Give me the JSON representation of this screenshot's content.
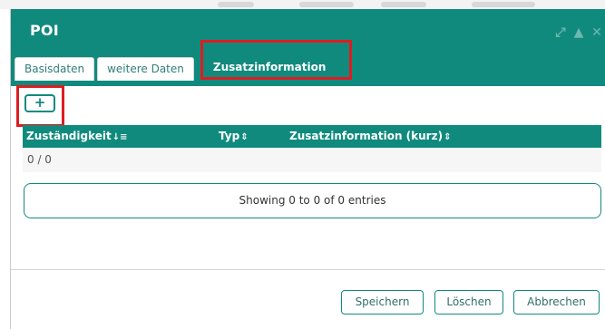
{
  "dialog": {
    "title": "POI",
    "window_controls": [
      "expand-icon",
      "arrow-up-icon",
      "close-icon"
    ]
  },
  "tabs": [
    {
      "label": "Basisdaten",
      "active": false
    },
    {
      "label": "weitere Daten",
      "active": false
    },
    {
      "label": "Zusatzinformation",
      "active": true
    }
  ],
  "toolbar": {
    "add_label": "+"
  },
  "table": {
    "columns": [
      {
        "label": "Zuständigkeit",
        "sort": "asc-icon"
      },
      {
        "label": "Typ",
        "sort": "sort-icon"
      },
      {
        "label": "Zusatzinformation (kurz)",
        "sort": "sort-icon"
      }
    ],
    "summary_row": "0 / 0",
    "info": "Showing 0 to 0 of 0 entries"
  },
  "footer": {
    "save_label": "Speichern",
    "delete_label": "Löschen",
    "cancel_label": "Abbrechen"
  },
  "colors": {
    "accent": "#118a7e",
    "highlight": "#dd1d20"
  }
}
